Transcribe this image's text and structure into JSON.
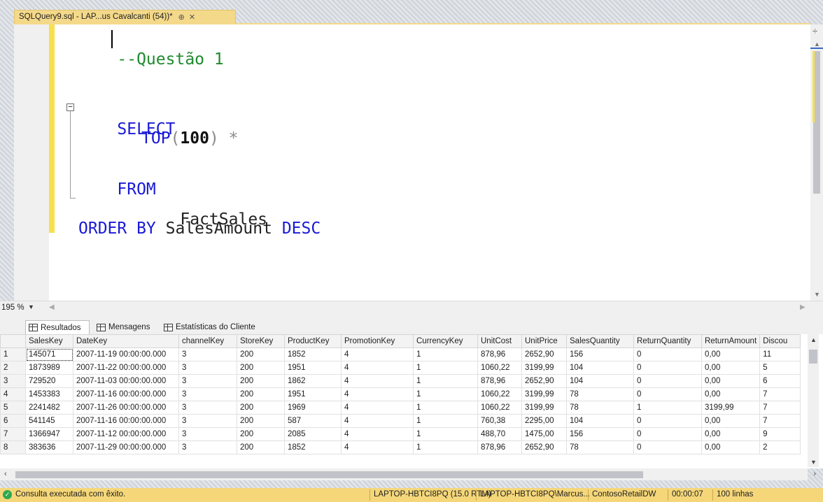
{
  "document_tab": {
    "title": "SQLQuery9.sql - LAP...us Cavalcanti (54))*",
    "pin_icon": "pin-icon",
    "close_icon": "close-icon"
  },
  "editor": {
    "comment": "--Questão 1",
    "select_kw": "SELECT",
    "top_kw": "TOP",
    "top_open": "(",
    "top_value": "100",
    "top_close": ")",
    "star": "*",
    "from_kw": "FROM",
    "table_name": "FactSales",
    "order_by_kw": "ORDER BY",
    "order_column": "SalesAmount",
    "desc_kw": "DESC",
    "fold_symbol": "−"
  },
  "zoom": {
    "value": "195 %"
  },
  "results_tabs": [
    {
      "label": "Resultados"
    },
    {
      "label": "Mensagens"
    },
    {
      "label": "Estatísticas do Cliente"
    }
  ],
  "grid": {
    "columns": [
      "",
      "SalesKey",
      "DateKey",
      "channelKey",
      "StoreKey",
      "ProductKey",
      "PromotionKey",
      "CurrencyKey",
      "UnitCost",
      "UnitPrice",
      "SalesQuantity",
      "ReturnQuantity",
      "ReturnAmount",
      "Discou"
    ],
    "rows": [
      [
        "1",
        "145071",
        "2007-11-19 00:00:00.000",
        "3",
        "200",
        "1852",
        "4",
        "1",
        "878,96",
        "2652,90",
        "156",
        "0",
        "0,00",
        "11"
      ],
      [
        "2",
        "1873989",
        "2007-11-22 00:00:00.000",
        "3",
        "200",
        "1951",
        "4",
        "1",
        "1060,22",
        "3199,99",
        "104",
        "0",
        "0,00",
        "5"
      ],
      [
        "3",
        "729520",
        "2007-11-03 00:00:00.000",
        "3",
        "200",
        "1862",
        "4",
        "1",
        "878,96",
        "2652,90",
        "104",
        "0",
        "0,00",
        "6"
      ],
      [
        "4",
        "1453383",
        "2007-11-16 00:00:00.000",
        "3",
        "200",
        "1951",
        "4",
        "1",
        "1060,22",
        "3199,99",
        "78",
        "0",
        "0,00",
        "7"
      ],
      [
        "5",
        "2241482",
        "2007-11-26 00:00:00.000",
        "3",
        "200",
        "1969",
        "4",
        "1",
        "1060,22",
        "3199,99",
        "78",
        "1",
        "3199,99",
        "7"
      ],
      [
        "6",
        "541145",
        "2007-11-16 00:00:00.000",
        "3",
        "200",
        "587",
        "4",
        "1",
        "760,38",
        "2295,00",
        "104",
        "0",
        "0,00",
        "7"
      ],
      [
        "7",
        "1366947",
        "2007-11-12 00:00:00.000",
        "3",
        "200",
        "2085",
        "4",
        "1",
        "488,70",
        "1475,00",
        "156",
        "0",
        "0,00",
        "9"
      ],
      [
        "8",
        "383636",
        "2007-11-29 00:00:00.000",
        "3",
        "200",
        "1852",
        "4",
        "1",
        "878,96",
        "2652,90",
        "78",
        "0",
        "0,00",
        "2"
      ]
    ]
  },
  "status_bar": {
    "message": "Consulta executada com êxito.",
    "server": "LAPTOP-HBTCI8PQ (15.0 RTM)",
    "user": "LAPTOP-HBTCI8PQ\\Marcus...",
    "database": "ContosoRetailDW",
    "elapsed": "00:00:07",
    "rows": "100 linhas"
  },
  "colors": {
    "tab_accent": "#f4d98a",
    "status_bar": "#f5d77a",
    "keyword": "#1a1ad6",
    "comment": "#1f8a2e",
    "change_bar": "#f7e04d",
    "success": "#2fa84f"
  }
}
